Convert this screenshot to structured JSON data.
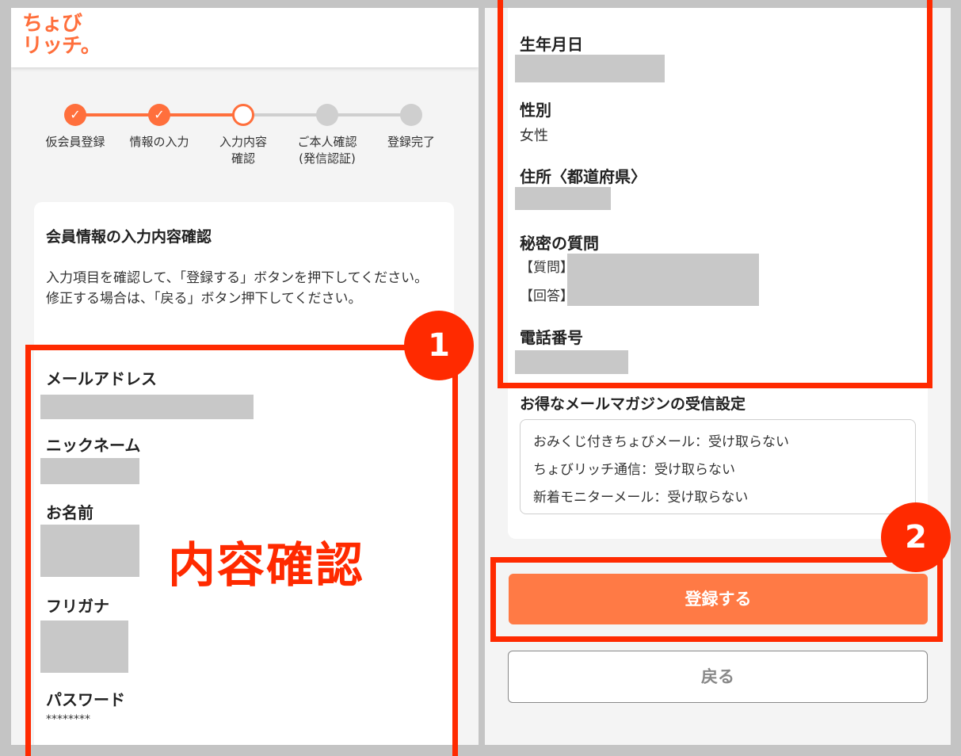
{
  "brand": {
    "logo_line1": "ちょび",
    "logo_line2": "リッチ。",
    "accent": "#ff6f3c",
    "highlight": "#ff2a00"
  },
  "stepper": {
    "steps": [
      {
        "label": "仮会員登録",
        "state": "done"
      },
      {
        "label": "情報の入力",
        "state": "done"
      },
      {
        "label": "入力内容\n確認",
        "state": "current"
      },
      {
        "label": "ご本人確認\n(発信認証)",
        "state": "todo"
      },
      {
        "label": "登録完了",
        "state": "todo"
      }
    ],
    "check_glyph": "✓"
  },
  "confirm_card": {
    "title": "会員情報の入力内容確認",
    "description": "入力項目を確認して、「登録する」ボタンを押下してください。\n修正する場合は、「戻る」ボタン押下してください。"
  },
  "fields_left": {
    "email_label": "メールアドレス",
    "nickname_label": "ニックネーム",
    "name_label": "お名前",
    "furigana_label": "フリガナ",
    "password_label": "パスワード",
    "password_value": "********"
  },
  "annotations": {
    "badge1": "1",
    "badge2": "2",
    "big_label": "内容確認"
  },
  "fields_right": {
    "birthdate_label": "生年月日",
    "gender_label": "性別",
    "gender_value": "女性",
    "prefecture_label": "住所〈都道府県〉",
    "secret_label": "秘密の質問",
    "question_prefix": "【質問】",
    "answer_prefix": "【回答】",
    "phone_label": "電話番号"
  },
  "magazine": {
    "label": "お得なメールマガジンの受信設定",
    "items": [
      "おみくじ付きちょびメール：受け取らない",
      "ちょびリッチ通信：受け取らない",
      "新着モニターメール：受け取らない"
    ]
  },
  "buttons": {
    "register": "登録する",
    "back": "戻る"
  }
}
